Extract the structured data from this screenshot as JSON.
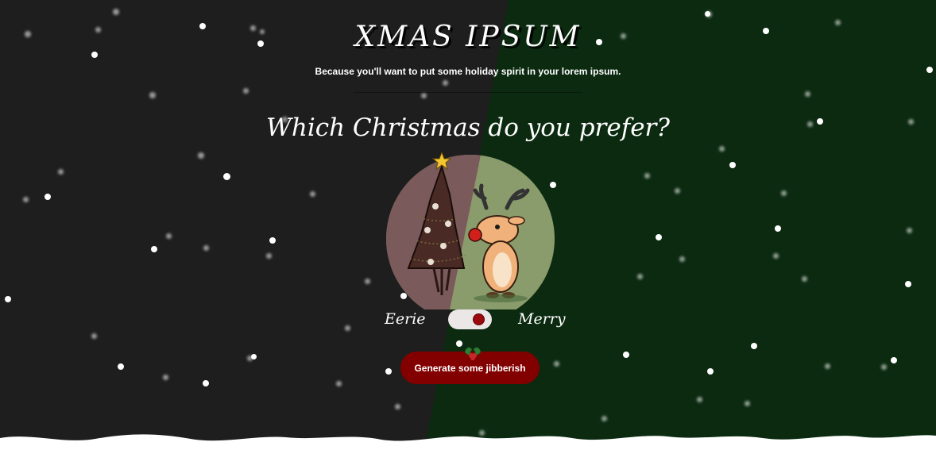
{
  "header": {
    "title": "XMAS IPSUM",
    "tagline": "Because you'll want to put some holiday spirit in your lorem ipsum."
  },
  "question": "Which Christmas do you prefer?",
  "toggle": {
    "left_label": "Eerie",
    "right_label": "Merry",
    "selected": "Merry"
  },
  "generate_button": {
    "label": "Generate some jibberish"
  },
  "colors": {
    "dark_bg": "#1e1e1e",
    "green_bg": "#0b2a10",
    "button": "#830000",
    "snow": "#ffffff"
  },
  "icons": {
    "illustration": "eerie-tree-and-reindeer-icon",
    "holly": "holly-icon",
    "snowflake": "snowflake-icon"
  }
}
